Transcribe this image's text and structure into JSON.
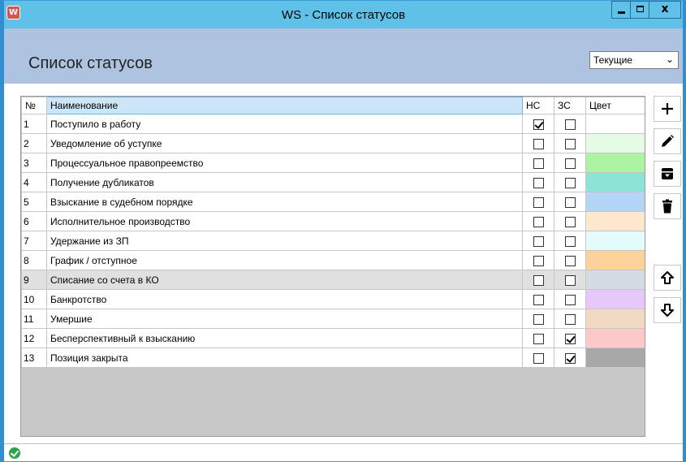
{
  "window": {
    "title": "WS - Список статусов",
    "app_icon_label": "W",
    "close_label": "x"
  },
  "header": {
    "page_title": "Список статусов",
    "filter_value": "Текущие",
    "filter_chevron": "⌄"
  },
  "table": {
    "columns": {
      "num": "№",
      "name": "Наименование",
      "hs": "НС",
      "zs": "ЗС",
      "color": "Цвет"
    },
    "rows": [
      {
        "num": "1",
        "name": "Поступило в работу",
        "hs": true,
        "zs": false,
        "color": "#ffffff"
      },
      {
        "num": "2",
        "name": "Уведомление об уступке",
        "hs": false,
        "zs": false,
        "color": "#e6fbe4"
      },
      {
        "num": "3",
        "name": "Процессуальное правопреемство",
        "hs": false,
        "zs": false,
        "color": "#adf3a4"
      },
      {
        "num": "4",
        "name": "Получение дубликатов",
        "hs": false,
        "zs": false,
        "color": "#8de4d6"
      },
      {
        "num": "5",
        "name": "Взыскание в судебном порядке",
        "hs": false,
        "zs": false,
        "color": "#b3d6f6"
      },
      {
        "num": "6",
        "name": "Исполнительное производство",
        "hs": false,
        "zs": false,
        "color": "#fde8ce"
      },
      {
        "num": "7",
        "name": "Удержание из ЗП",
        "hs": false,
        "zs": false,
        "color": "#e4fbfb"
      },
      {
        "num": "8",
        "name": "График / отступное",
        "hs": false,
        "zs": false,
        "color": "#fdd29b"
      },
      {
        "num": "9",
        "name": "Списание со счета в КО",
        "hs": false,
        "zs": false,
        "color": "#d3dbe3",
        "selected": true
      },
      {
        "num": "10",
        "name": "Банкротство",
        "hs": false,
        "zs": false,
        "color": "#e8c8fb"
      },
      {
        "num": "11",
        "name": "Умершие",
        "hs": false,
        "zs": false,
        "color": "#f1d9c4"
      },
      {
        "num": "12",
        "name": "Бесперспективный к взысканию",
        "hs": false,
        "zs": true,
        "color": "#fdc8c8"
      },
      {
        "num": "13",
        "name": "Позиция закрыта",
        "hs": false,
        "zs": true,
        "color": "#a8a8a8"
      }
    ]
  },
  "toolbar": {
    "buttons": [
      "plus-icon",
      "pencil-icon",
      "archive-icon",
      "trash-icon",
      "arrow-up-icon",
      "arrow-down-icon"
    ]
  },
  "status": {
    "icon": "ok-check-icon",
    "color": "#2ea34a"
  }
}
